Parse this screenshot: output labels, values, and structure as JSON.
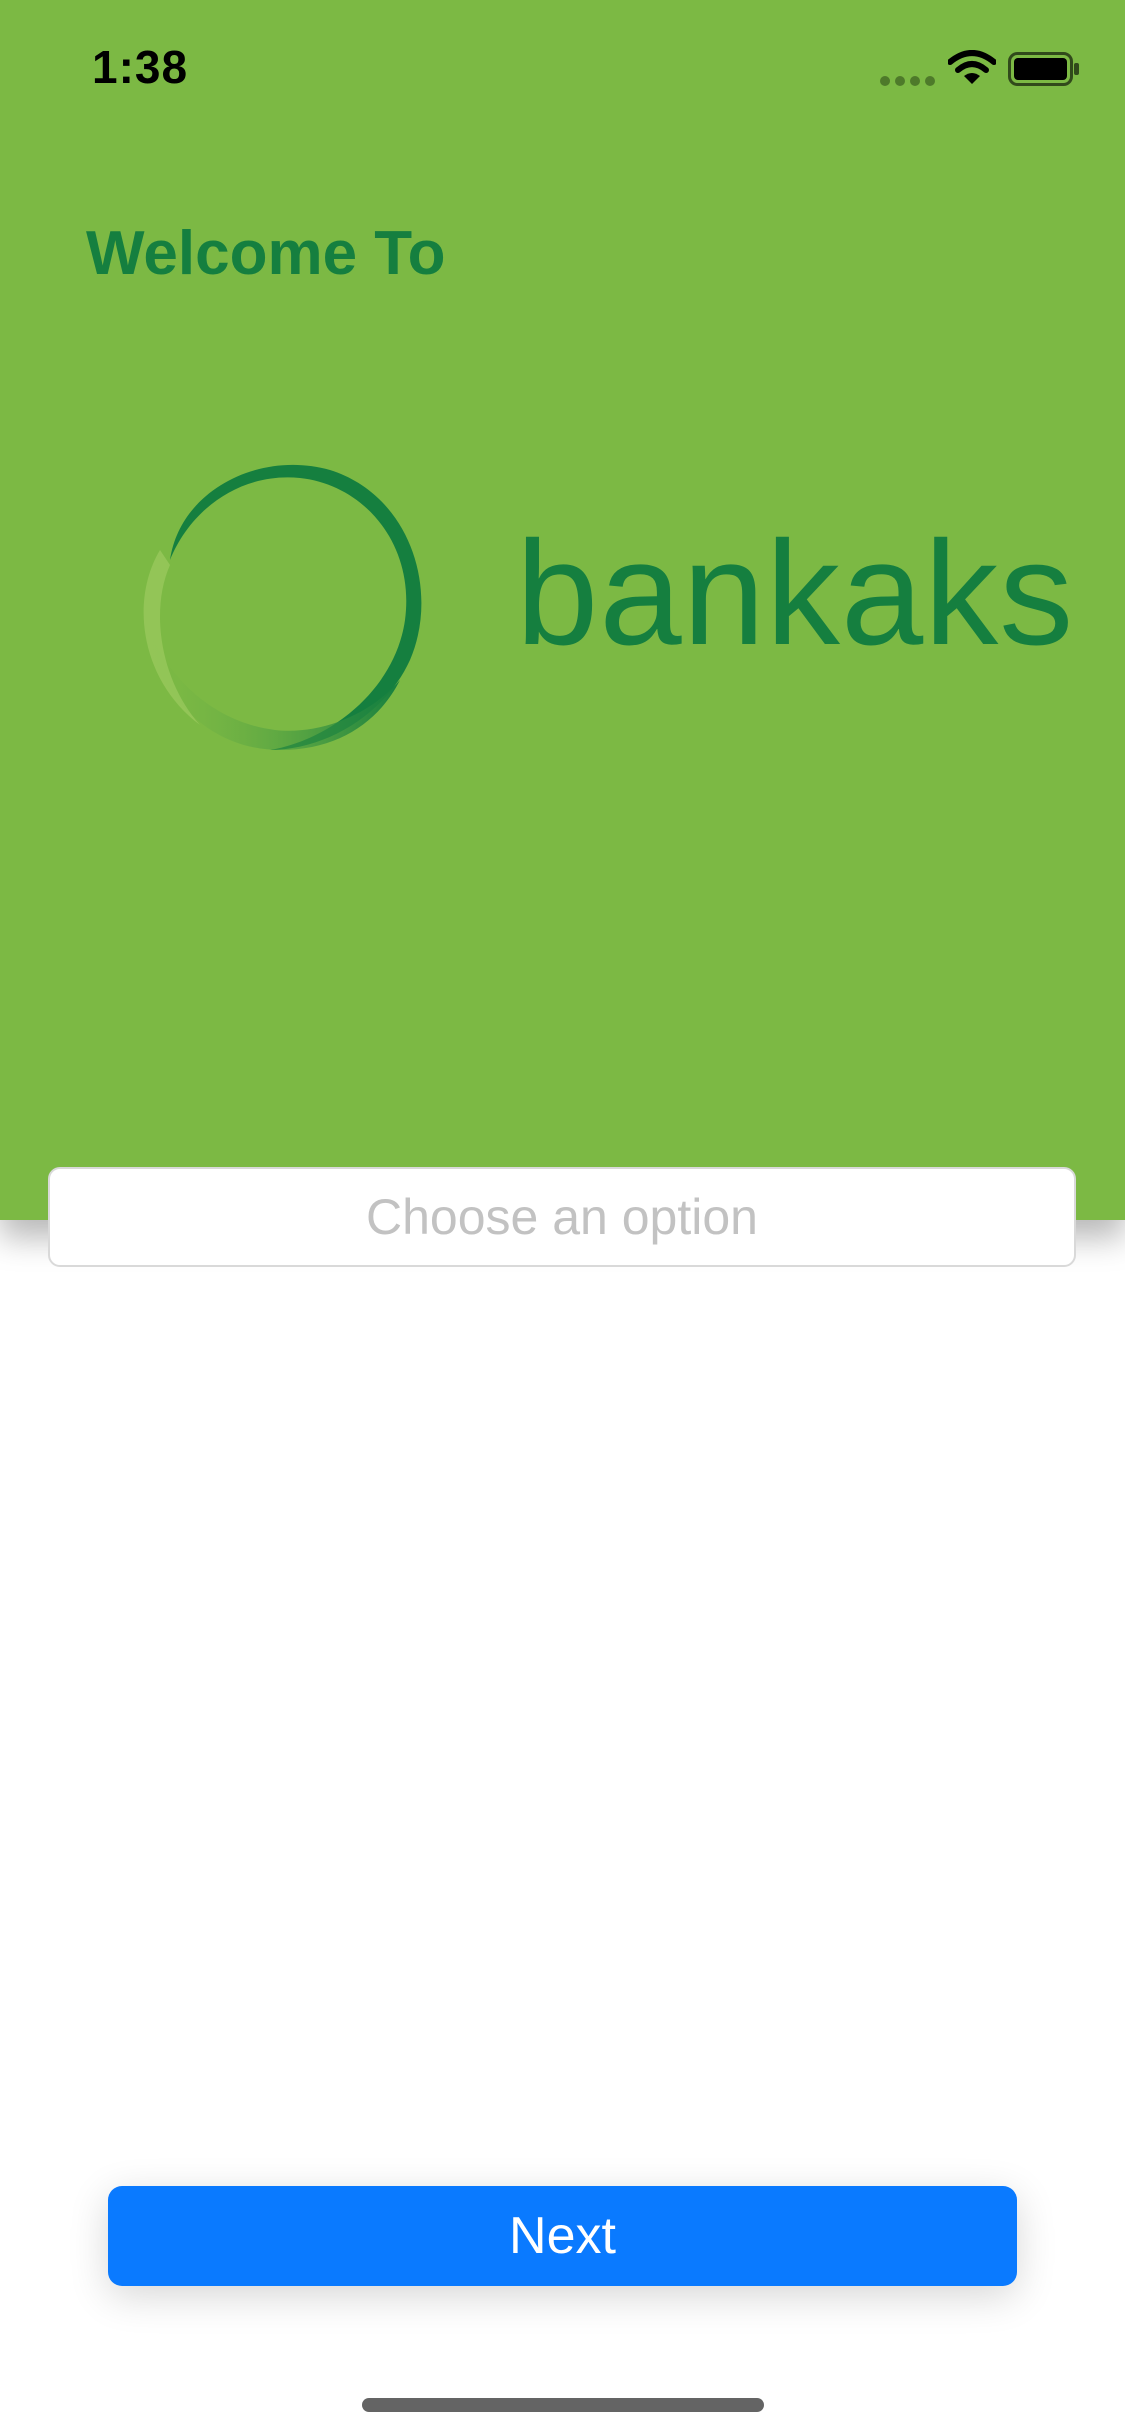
{
  "status_bar": {
    "time": "1:38"
  },
  "header": {
    "welcome_text": "Welcome To",
    "brand_name": "bankaks",
    "background_color": "#7cb944",
    "brand_color": "#157f3f"
  },
  "option_select": {
    "placeholder": "Choose an option"
  },
  "next_button": {
    "label": "Next",
    "color": "#0a7aff"
  },
  "icons": {
    "signal": "signal-icon",
    "wifi": "wifi-icon",
    "battery": "battery-icon",
    "logo": "bankaks-logo-icon"
  }
}
